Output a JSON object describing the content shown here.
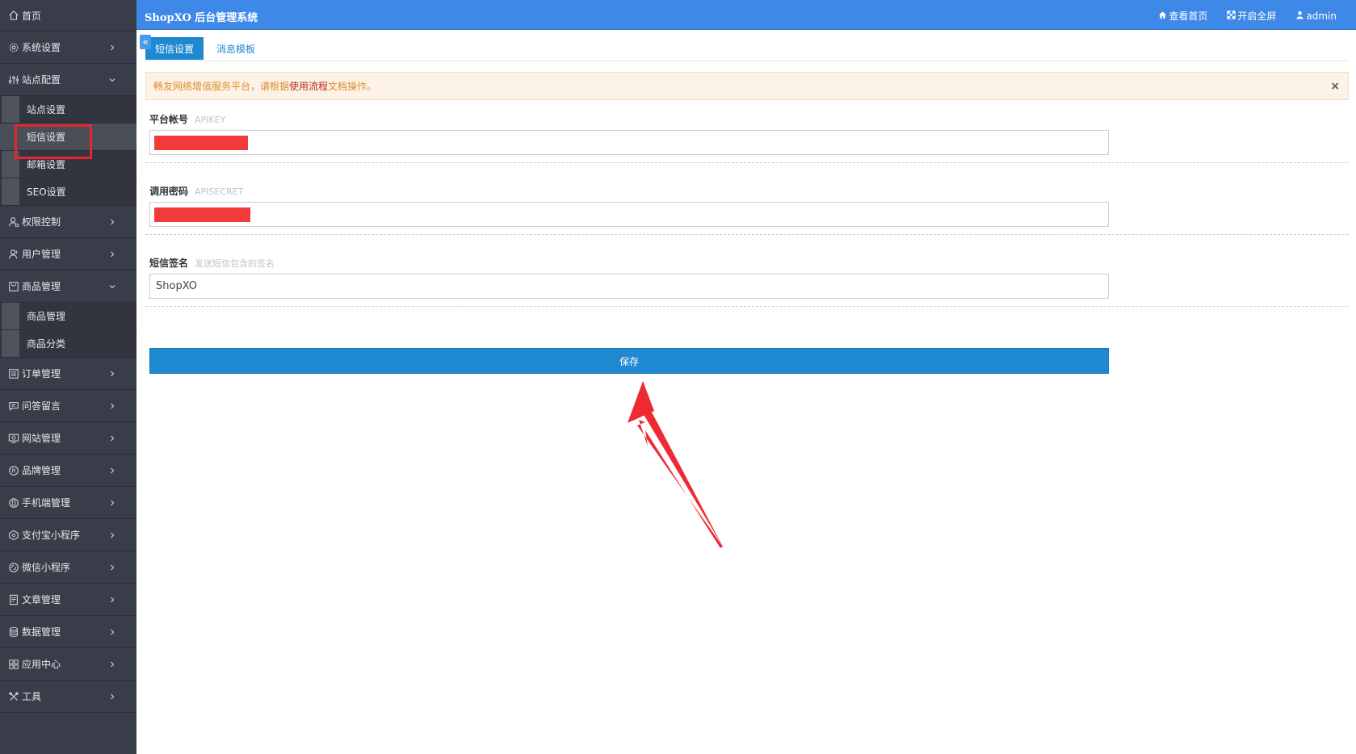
{
  "colors": {
    "sidebar": "#393d49",
    "header": "#3e88e8",
    "primary": "#1e88d0",
    "alert_bg": "#fcf2e6",
    "alert_text": "#e08e2f",
    "highlight": "#e8262f"
  },
  "header": {
    "title": "ShopXO 后台管理系统",
    "links": [
      {
        "icon": "home-icon",
        "label": "查看首页"
      },
      {
        "icon": "fullscreen-icon",
        "label": "开启全屏"
      },
      {
        "icon": "user-icon",
        "label": "admin"
      }
    ]
  },
  "sidebar": {
    "home": {
      "icon": "home-icon",
      "label": "首页"
    },
    "items": [
      {
        "icon": "gear-icon",
        "label": "系统设置"
      },
      {
        "icon": "sliders-icon",
        "label": "站点配置",
        "sub": [
          "站点设置",
          "短信设置",
          "邮箱设置",
          "SEO设置"
        ]
      },
      {
        "icon": "user-lock-icon",
        "label": "权限控制"
      },
      {
        "icon": "users-icon",
        "label": "用户管理"
      },
      {
        "icon": "goods-icon",
        "label": "商品管理",
        "sub": [
          "商品管理",
          "商品分类"
        ]
      },
      {
        "icon": "order-icon",
        "label": "订单管理"
      },
      {
        "icon": "message-icon",
        "label": "问答留言"
      },
      {
        "icon": "website-icon",
        "label": "网站管理"
      },
      {
        "icon": "brand-icon",
        "label": "品牌管理"
      },
      {
        "icon": "mobile-icon",
        "label": "手机端管理"
      },
      {
        "icon": "alipay-icon",
        "label": "支付宝小程序"
      },
      {
        "icon": "wechat-icon",
        "label": "微信小程序"
      },
      {
        "icon": "article-icon",
        "label": "文章管理"
      },
      {
        "icon": "database-icon",
        "label": "数据管理"
      },
      {
        "icon": "apps-icon",
        "label": "应用中心"
      },
      {
        "icon": "tools-icon",
        "label": "工具"
      }
    ]
  },
  "tabs": [
    "短信设置",
    "消息模板"
  ],
  "alert": {
    "prefix": "畅友网络增值服务平台，请根据",
    "link": "使用流程",
    "suffix": "文档操作。",
    "close": "×"
  },
  "form": {
    "apikey": {
      "label": "平台帐号",
      "hint": "APIKEY",
      "value": ""
    },
    "apisecret": {
      "label": "调用密码",
      "hint": "APISECRET",
      "value": ""
    },
    "sign": {
      "label": "短信签名",
      "hint": "发送短信包含的签名",
      "value": "ShopXO"
    }
  },
  "save_label": "保存"
}
